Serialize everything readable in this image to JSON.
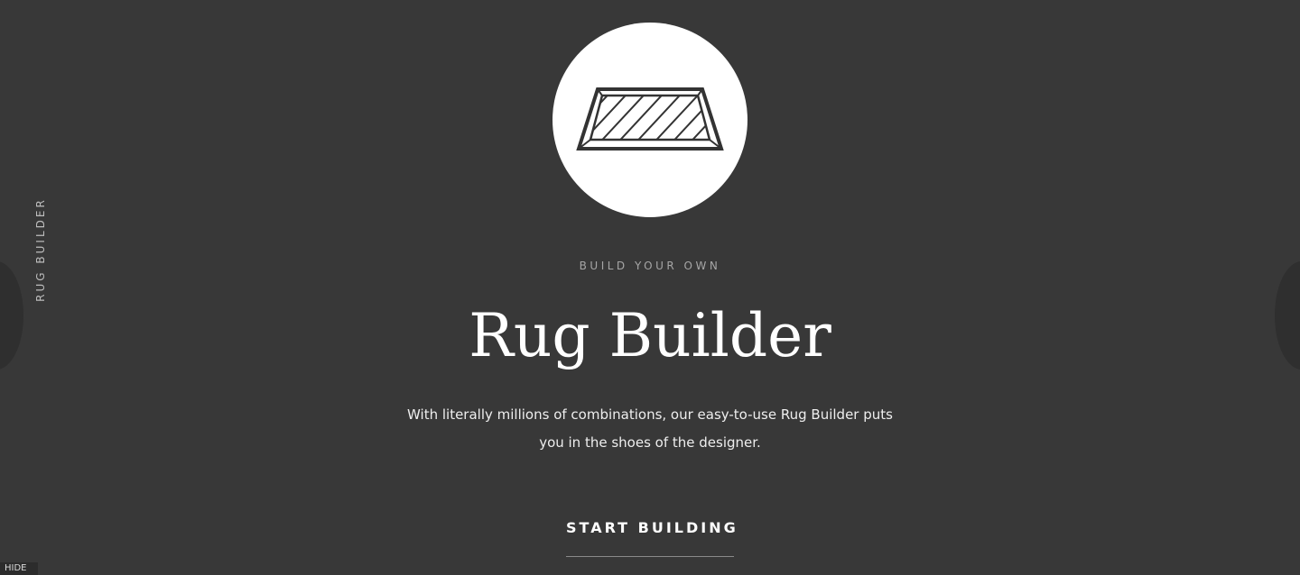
{
  "side_nav": {
    "label": "RUG BUILDER"
  },
  "hero": {
    "icon": "rug-icon",
    "eyebrow": "BUILD YOUR OWN",
    "title": "Rug Builder",
    "description": "With literally millions of combinations, our easy-to-use Rug Builder puts you in the shoes of the designer.",
    "cta_label": "START BUILDING"
  },
  "footer": {
    "hide_label": "HIDE"
  },
  "colors": {
    "background": "#383838",
    "circle": "#ffffff",
    "icon_stroke": "#333333",
    "text": "#ffffff",
    "muted_text": "#a6a6a6"
  }
}
